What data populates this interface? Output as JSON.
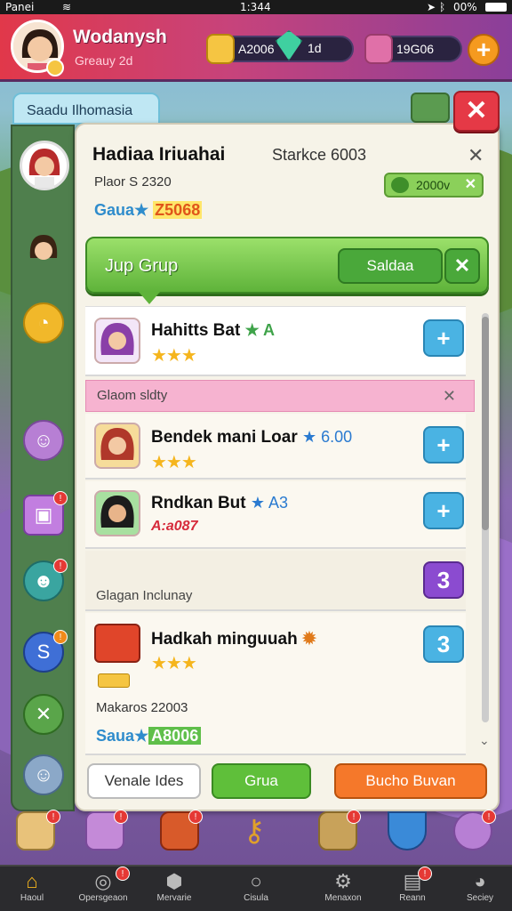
{
  "status_bar": {
    "carrier": "Panei",
    "time": "1:344",
    "battery": "00%"
  },
  "profile": {
    "name": "Wodanysh",
    "subtitle": "Greauy 2d"
  },
  "currencies": [
    {
      "name": "coins",
      "value": "A2006",
      "icon": "coin-icon",
      "color": "#f5c542"
    },
    {
      "name": "gems",
      "value": "1d",
      "icon": "gem-icon",
      "color": "#3fd0a0"
    },
    {
      "name": "energy",
      "value": "19G06",
      "icon": "chest-icon",
      "color": "#e070a8"
    }
  ],
  "tab_label": "Saadu Ilhomasia",
  "panel": {
    "title": "Hadiaa Iriuahai",
    "status": "Starkce 6003",
    "meta": "Plaor S 2320",
    "currency_label": "Gaua★",
    "currency_value": "Z5068",
    "badge_value": "2000v"
  },
  "group_bar": {
    "title": "Jup Grup",
    "select_label": "Saldaa"
  },
  "rows": [
    {
      "name": "Hahitts Bat",
      "suffix": "★ A",
      "stars": "★★★"
    },
    {
      "name": "Bendek mani Loar",
      "suffix": "★ 6.00",
      "stars": "★★★"
    },
    {
      "name": "Rndkan But",
      "suffix": "★ A3",
      "stars": "",
      "price": "A:a087"
    }
  ],
  "pink_section": {
    "label": "Glaom sldty"
  },
  "info_section": {
    "label": "Glagan Inclunay",
    "count": "3"
  },
  "chest_row": {
    "name": "Hadkah minguuah",
    "stars": "★★★",
    "count": "3",
    "meta": "Makaros 22003",
    "currency_label": "Saua★",
    "currency_value": "A8006"
  },
  "buttons": {
    "left": "Venale Ides",
    "middle": "Grua",
    "right": "Bucho Buvan"
  },
  "nav": [
    {
      "label": "Haoul",
      "icon": "home-icon"
    },
    {
      "label": "Opersgeaon",
      "icon": "globe-icon"
    },
    {
      "label": "Mervarie",
      "icon": "shield-icon"
    },
    {
      "label": "Cisula",
      "icon": "ring-icon"
    },
    {
      "label": "Menaxon",
      "icon": "gear-icon"
    },
    {
      "label": "Reann",
      "icon": "card-icon"
    },
    {
      "label": "Seciey",
      "icon": "chat-icon"
    }
  ]
}
